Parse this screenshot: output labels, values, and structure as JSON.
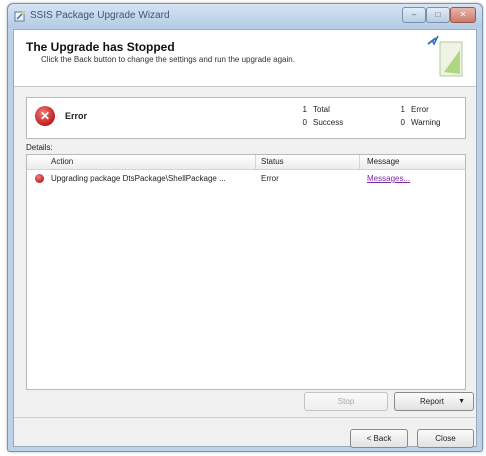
{
  "window": {
    "title": "SSIS Package Upgrade Wizard",
    "controls": {
      "minimize": "–",
      "maximize": "□",
      "close": "✕"
    }
  },
  "header": {
    "title": "The Upgrade has Stopped",
    "subtitle": "Click the Back button to change the settings and run the upgrade again."
  },
  "summary": {
    "status_label": "Error",
    "status_icon": "error-icon",
    "total_count": "1",
    "total_label": "Total",
    "success_count": "0",
    "success_label": "Success",
    "error_count": "1",
    "error_label": "Error",
    "warning_count": "0",
    "warning_label": "Warning"
  },
  "details": {
    "label": "Details:",
    "columns": {
      "action": "Action",
      "status": "Status",
      "message": "Message"
    },
    "rows": [
      {
        "icon": "error-icon",
        "action": "Upgrading package DtsPackage\\ShellPackage ...",
        "status": "Error",
        "message": "Messages..."
      }
    ]
  },
  "buttons": {
    "stop": "Stop",
    "report": "Report",
    "back": "< Back",
    "close": "Close"
  },
  "colors": {
    "error": "#c31e1e",
    "link": "#7a2b9e",
    "frame": "#bcd2e8"
  }
}
